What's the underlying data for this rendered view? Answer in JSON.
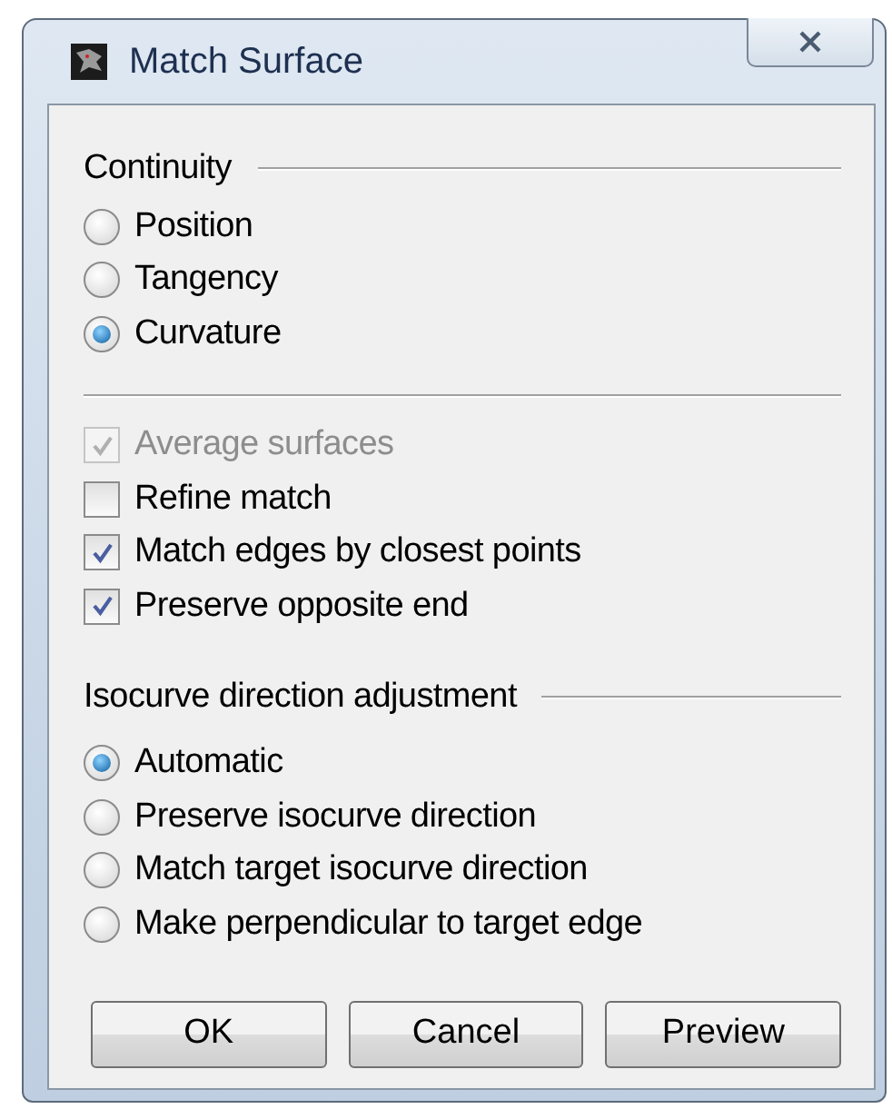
{
  "window": {
    "title": "Match Surface"
  },
  "continuity": {
    "label": "Continuity",
    "options": [
      {
        "label": "Position",
        "selected": false
      },
      {
        "label": "Tangency",
        "selected": false
      },
      {
        "label": "Curvature",
        "selected": true
      }
    ]
  },
  "checkboxes": [
    {
      "label": "Average surfaces",
      "checked": true,
      "disabled": true
    },
    {
      "label": "Refine match",
      "checked": false,
      "disabled": false
    },
    {
      "label": "Match edges by closest points",
      "checked": true,
      "disabled": false
    },
    {
      "label": "Preserve opposite end",
      "checked": true,
      "disabled": false
    }
  ],
  "isocurve": {
    "label": "Isocurve direction adjustment",
    "options": [
      {
        "label": "Automatic",
        "selected": true
      },
      {
        "label": "Preserve isocurve direction",
        "selected": false
      },
      {
        "label": "Match target isocurve direction",
        "selected": false
      },
      {
        "label": "Make perpendicular to target edge",
        "selected": false
      }
    ]
  },
  "buttons": [
    "OK",
    "Cancel",
    "Preview"
  ]
}
